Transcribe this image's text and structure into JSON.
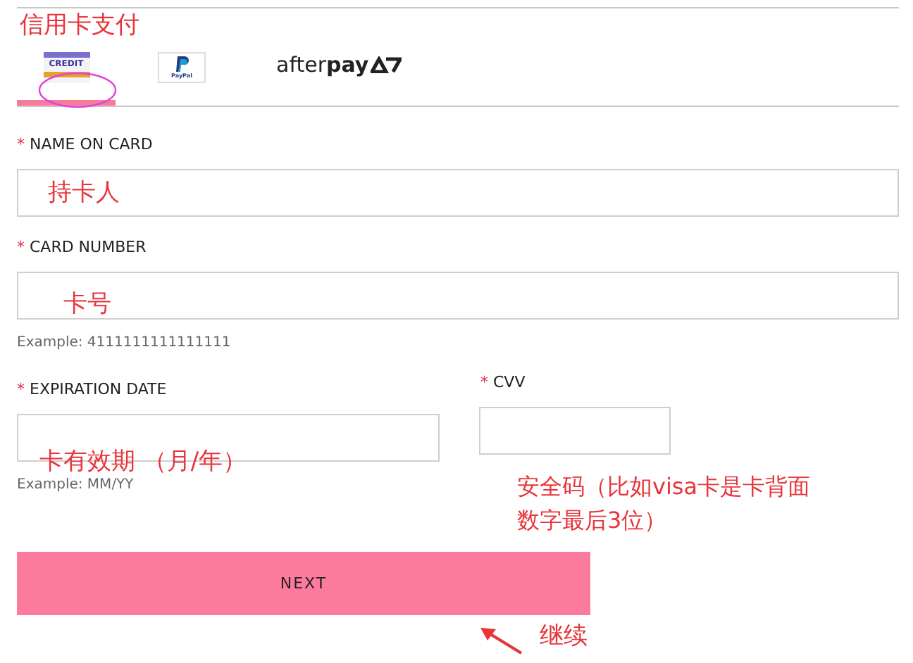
{
  "tabs": [
    {
      "kind": "credit",
      "label": "CREDIT",
      "selected": true
    },
    {
      "kind": "paypal",
      "label": "PayPal",
      "selected": false
    },
    {
      "kind": "afterpay",
      "label": "after**pay**",
      "selected": false
    }
  ],
  "fields": [
    {
      "marker": "*",
      "label": "NAME ON CARD"
    },
    {
      "marker": "*",
      "label": "CARD NUMBER",
      "hint": "Example: 4111111111111111"
    }
  ],
  "row_fields": [
    {
      "marker": "*",
      "label": "EXPIRATION DATE",
      "hint": "Example: MM/YY"
    },
    {
      "marker": "*",
      "label": "CVV"
    }
  ],
  "next_button": "NEXT",
  "annotations": {
    "title": "信用卡支付",
    "name": "持卡人",
    "number": "卡号",
    "expiry": "卡有效期 （月/年）",
    "cvv": [
      "安全码（比如visa卡是卡背面",
      "数字最后3位）"
    ],
    "next": "继续"
  }
}
